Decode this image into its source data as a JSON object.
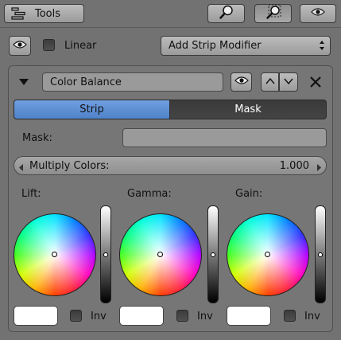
{
  "header": {
    "tools_label": "Tools"
  },
  "modifier_row": {
    "linear_label": "Linear",
    "add_modifier_label": "Add Strip Modifier"
  },
  "modifier": {
    "name": "Color Balance",
    "tabs": [
      {
        "label": "Strip",
        "active": true
      },
      {
        "label": "Mask",
        "active": false
      }
    ],
    "mask_label": "Mask:",
    "mask_value": "",
    "multiply_label": "Multiply Colors:",
    "multiply_value": "1.000",
    "wheels": [
      {
        "label": "Lift:",
        "inv_label": "Inv",
        "value_level": 0.5
      },
      {
        "label": "Gamma:",
        "inv_label": "Inv",
        "value_level": 0.5
      },
      {
        "label": "Gain:",
        "inv_label": "Inv",
        "value_level": 0.5
      }
    ]
  },
  "colors": {
    "active_tab": "#5b8fd6",
    "inactive_tab": "#3d3d3d",
    "background": "#727272"
  },
  "icons": {
    "tools": "tools-toggle-icon",
    "zoom": "zoom-icon",
    "zoom_border": "zoom-border-icon",
    "eye": "eye-icon",
    "close": "close-icon"
  }
}
